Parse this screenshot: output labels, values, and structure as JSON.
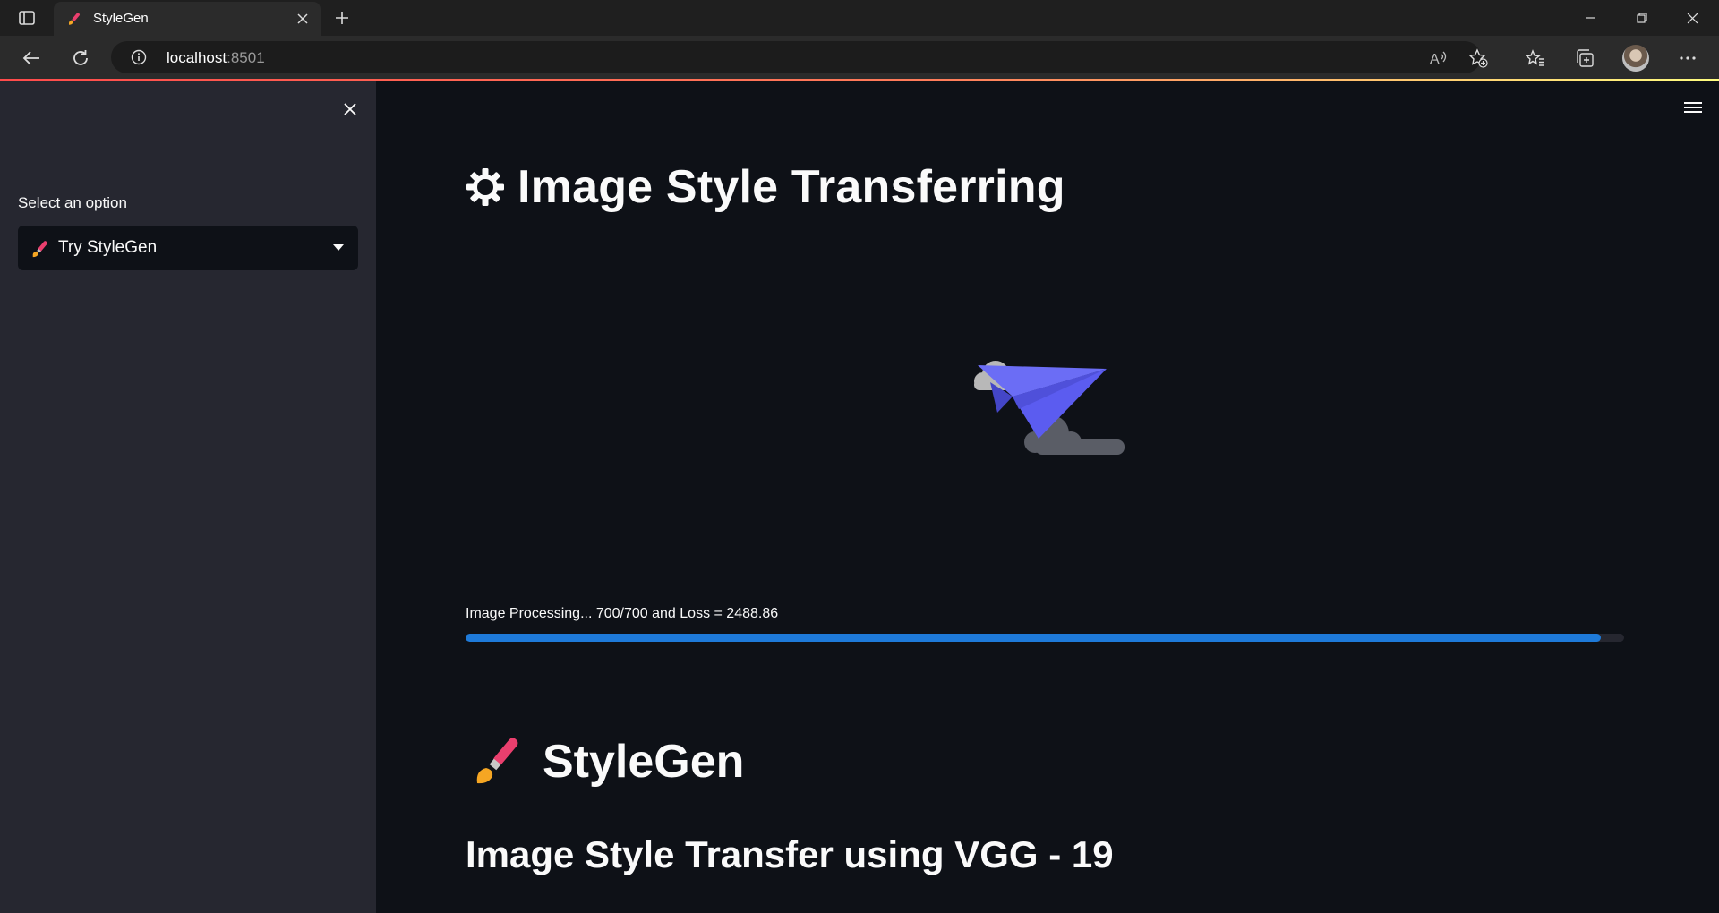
{
  "browser": {
    "tab_title": "StyleGen",
    "url_host": "localhost",
    "url_port": ":8501"
  },
  "sidebar": {
    "select_label": "Select an option",
    "select_value": "Try StyleGen"
  },
  "main": {
    "title": "Image Style Transferring",
    "progress": {
      "label": "Image Processing... 700/700 and Loss = 2488.86",
      "value": 0.98
    },
    "heading": "StyleGen",
    "subheading": "Image Style Transfer using VGG - 19"
  },
  "colors": {
    "primary": "#1e7ad9",
    "background": "#0e1117",
    "sidebar": "#262730",
    "plane": "#5b5cf0"
  },
  "icons": [
    "tab-sidebar-icon",
    "paintbrush-icon",
    "close-icon",
    "plus-icon",
    "back-arrow-icon",
    "refresh-icon",
    "info-icon",
    "read-aloud-icon",
    "favorite-add-icon",
    "favorites-icon",
    "collections-icon",
    "more-icon",
    "gear-icon",
    "hamburger-icon",
    "paper-plane-icon"
  ]
}
